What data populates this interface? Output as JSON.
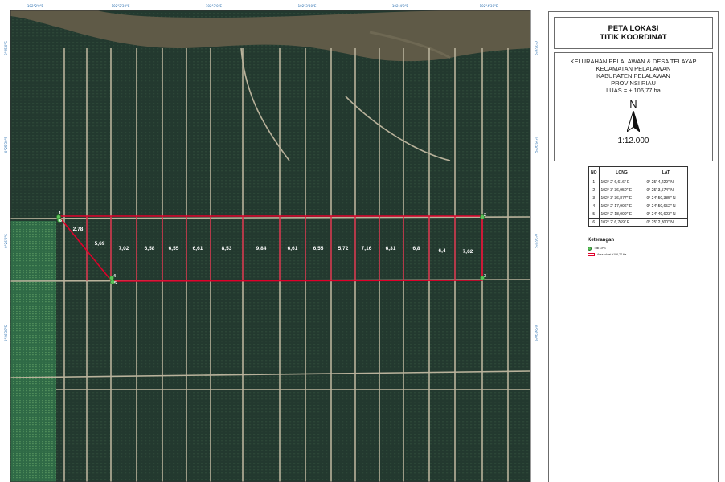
{
  "map": {
    "longitude_ticks": [
      "102°2'0\"E",
      "102°2'30\"E",
      "102°3'0\"E",
      "102°3'30\"E",
      "102°4'0\"E",
      "102°4'30\"E"
    ],
    "latitude_ticks": [
      "0°25'0\"S",
      "0°25'30\"S",
      "0°26'0\"S",
      "0°26'30\"S"
    ],
    "plot_labels": [
      "2,78",
      "5,69",
      "7,02",
      "6,58",
      "6,55",
      "6,61",
      "8,53",
      "9,84",
      "6,61",
      "6,55",
      "5,72",
      "7,16",
      "6,31",
      "6,8",
      "6,4",
      "7,62"
    ],
    "point_labels": [
      "1",
      "6",
      "2",
      "3",
      "4",
      "5"
    ],
    "colors": {
      "boundary": "#e0002a",
      "point_marker": "#5ac15a",
      "river": "#5f5a47",
      "canopy": "#1f3a2e"
    }
  },
  "panel": {
    "title": [
      "PETA LOKASI",
      "TITIK KOORDINAT"
    ],
    "location_lines": [
      "KELURAHAN PELALAWAN & DESA TELAYAP",
      "KECAMATAN PELALAWAN",
      "KABUPATEN PELALAWAN",
      "PROVINSI RIAU",
      "LUAS = ± 106,77 ha"
    ],
    "north_label": "N",
    "north_arrow_icon": "north-arrow-icon",
    "scale": "1:12.000"
  },
  "table": {
    "headers": [
      "NO",
      "LONG",
      "LAT"
    ],
    "rows": [
      [
        "1",
        "102° 2' 6,616\" E",
        "0° 25' 4,229\" N"
      ],
      [
        "2",
        "102° 3' 36,950\" E",
        "0° 25' 3,574\" N"
      ],
      [
        "3",
        "102° 3' 36,877\" E",
        "0° 24' 50,385\" N"
      ],
      [
        "4",
        "102° 2' 17,996\" E",
        "0° 24' 50,652\" N"
      ],
      [
        "5",
        "102° 2' 18,099\" E",
        "0° 24' 49,623\" N"
      ],
      [
        "6",
        "102° 2' 6,769\" E",
        "0° 25' 2,800\" N"
      ]
    ]
  },
  "legend": {
    "title": "Keterangan",
    "items": [
      "Titik GPS",
      "Area lokasi ±106,77 Ha"
    ]
  }
}
